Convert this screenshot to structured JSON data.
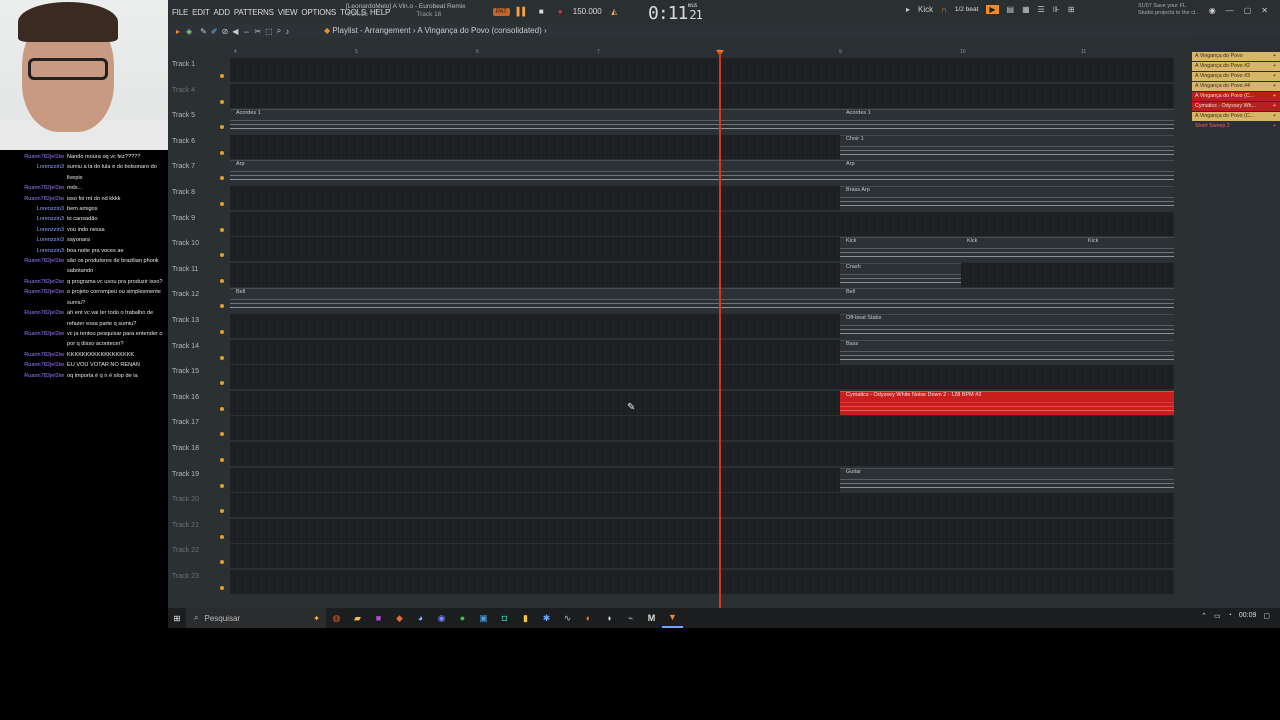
{
  "webcam": {
    "label": ""
  },
  "chat": [
    {
      "user": "Ruann782jel2iw",
      "color": "purple",
      "msg": "Nando moura oq vc fez?????"
    },
    {
      "user": "Lorenzzin3",
      "color": "blue",
      "msg": "sumiu a la do lula e do bolsonaro do llvepix"
    },
    {
      "user": "Ruann782jel2iw",
      "color": "purple",
      "msg": "mds..."
    },
    {
      "user": "Ruann782jel2iw",
      "color": "purple",
      "msg": "isso foi mt do nd kkkk"
    },
    {
      "user": "Lorenzzin3",
      "color": "blue",
      "msg": "bem amigos"
    },
    {
      "user": "Lorenzzin3",
      "color": "blue",
      "msg": "to cansadão"
    },
    {
      "user": "Lorenzzin3",
      "color": "blue",
      "msg": "vou indo nessa"
    },
    {
      "user": "Lorenzzin3",
      "color": "blue",
      "msg": "sayonara"
    },
    {
      "user": "Lorenzzin3",
      "color": "blue",
      "msg": "boa noite pra voces ae"
    },
    {
      "user": "Ruann782jel2iw",
      "color": "purple",
      "msg": "são os produtores de brazilian phonk sabotando"
    },
    {
      "user": "Ruann782jel2iw",
      "color": "purple",
      "msg": "q programa vc usou pra produzir isso?"
    },
    {
      "user": "Ruann782jel2iw",
      "color": "purple",
      "msg": "o projeto corrompeu ou simplesmente sumiu?"
    },
    {
      "user": "Ruann782jel2iw",
      "color": "purple",
      "msg": "ah ent vc vai ter todo o trabalho de refazer essa parte q sumiu?"
    },
    {
      "user": "Ruann782jel2iw",
      "color": "purple",
      "msg": "vc ja tentou pesquisar para entender o por q disso acontecer?"
    },
    {
      "user": "Ruann782jel2iw",
      "color": "purple",
      "msg": "KKKKKKKKKKKKKKKKKK"
    },
    {
      "user": "Ruann782jel2iw",
      "color": "purple",
      "msg": "EU VOU VOTAR NO RENAN"
    },
    {
      "user": "Ruann782jel2iw",
      "color": "purple",
      "msg": "oq importa é q n é slop de ia"
    }
  ],
  "menu": [
    "FILE",
    "EDIT",
    "ADD",
    "PATTERNS",
    "VIEW",
    "OPTIONS",
    "TOOLS",
    "HELP"
  ],
  "song": {
    "line1": "[LeonardoMelo] A Vin.o - Eurobeat Remix",
    "line2_time": "4:04:16",
    "line2_track": "Track 16"
  },
  "transport": {
    "pat": "PAT",
    "play": "▌▌",
    "stop": "■",
    "rec": "●",
    "bpm": "150.000"
  },
  "clock": {
    "time": "0:11",
    "frac": "21",
    "unit": "M:S:CS"
  },
  "tool": {
    "instrument": "Kick",
    "snap": "1/2 beat"
  },
  "save_hint": {
    "line1": "31/07 Save your FL",
    "line2": "Studio projects to the cl.."
  },
  "playlist": {
    "prefix": "Playlist - Arrangement",
    "sep": "›",
    "name": "A Vingança do Povo (consolidated)",
    "suffix": "›"
  },
  "ruler": [
    "4",
    "5",
    "6",
    "7",
    "8",
    "9",
    "10",
    "11"
  ],
  "tracks": [
    {
      "label": "Track 1"
    },
    {
      "label": "Track 4"
    },
    {
      "label": "Track 5",
      "clips": [
        {
          "name": "Acordes 1"
        },
        {
          "name": "Acordes 1"
        }
      ]
    },
    {
      "label": "Track 6",
      "clips": [
        {
          "name": "Choir 1"
        }
      ]
    },
    {
      "label": "Track 7",
      "clips": [
        {
          "name": "Arp"
        },
        {
          "name": "Arp"
        }
      ]
    },
    {
      "label": "Track 8",
      "clips": [
        {
          "name": "Brass Arp"
        }
      ]
    },
    {
      "label": "Track 9"
    },
    {
      "label": "Track 10",
      "clips": [
        {
          "name": "Kick"
        },
        {
          "name": "Kick"
        },
        {
          "name": "Kick"
        }
      ]
    },
    {
      "label": "Track 11",
      "clips": [
        {
          "name": "Crash"
        }
      ]
    },
    {
      "label": "Track 12",
      "clips": [
        {
          "name": "Bell"
        },
        {
          "name": "Bell"
        }
      ]
    },
    {
      "label": "Track 13",
      "clips": [
        {
          "name": "Off-beat Stabs"
        }
      ]
    },
    {
      "label": "Track 14",
      "clips": [
        {
          "name": "Bass"
        }
      ]
    },
    {
      "label": "Track 15"
    },
    {
      "label": "Track 16",
      "clips": [
        {
          "name": "Cymatics - Odyssey White Noise Down 2 - 128 BPM #2"
        }
      ]
    },
    {
      "label": "Track 17"
    },
    {
      "label": "Track 18"
    },
    {
      "label": "Track 19",
      "clips": [
        {
          "name": "Guitar"
        }
      ]
    },
    {
      "label": "Track 20"
    },
    {
      "label": "Track 21"
    },
    {
      "label": "Track 22"
    },
    {
      "label": "Track 23"
    }
  ],
  "browser": [
    {
      "name": "A Vingança do Povo",
      "style": "gold"
    },
    {
      "name": "A Vingança do Povo #2",
      "style": "gold"
    },
    {
      "name": "A Vingança do Povo #3",
      "style": "gold"
    },
    {
      "name": "A Vingança do Povo #4",
      "style": "gold"
    },
    {
      "name": "A Vingança do Povo (C...",
      "style": "red"
    },
    {
      "name": "Cymatics - Odyssey Wh...",
      "style": "red"
    },
    {
      "name": "A Vingança do Povo (C...",
      "style": "gold"
    },
    {
      "name": "Short Sweep 2",
      "style": "pink"
    }
  ],
  "taskbar": {
    "search": "Pesquisar",
    "clock": "00:09"
  },
  "colors": {
    "accent": "#f08a2a",
    "playhead": "#d33a1a",
    "red_clip": "#c81e1e",
    "gold_clip": "#d7b569"
  }
}
